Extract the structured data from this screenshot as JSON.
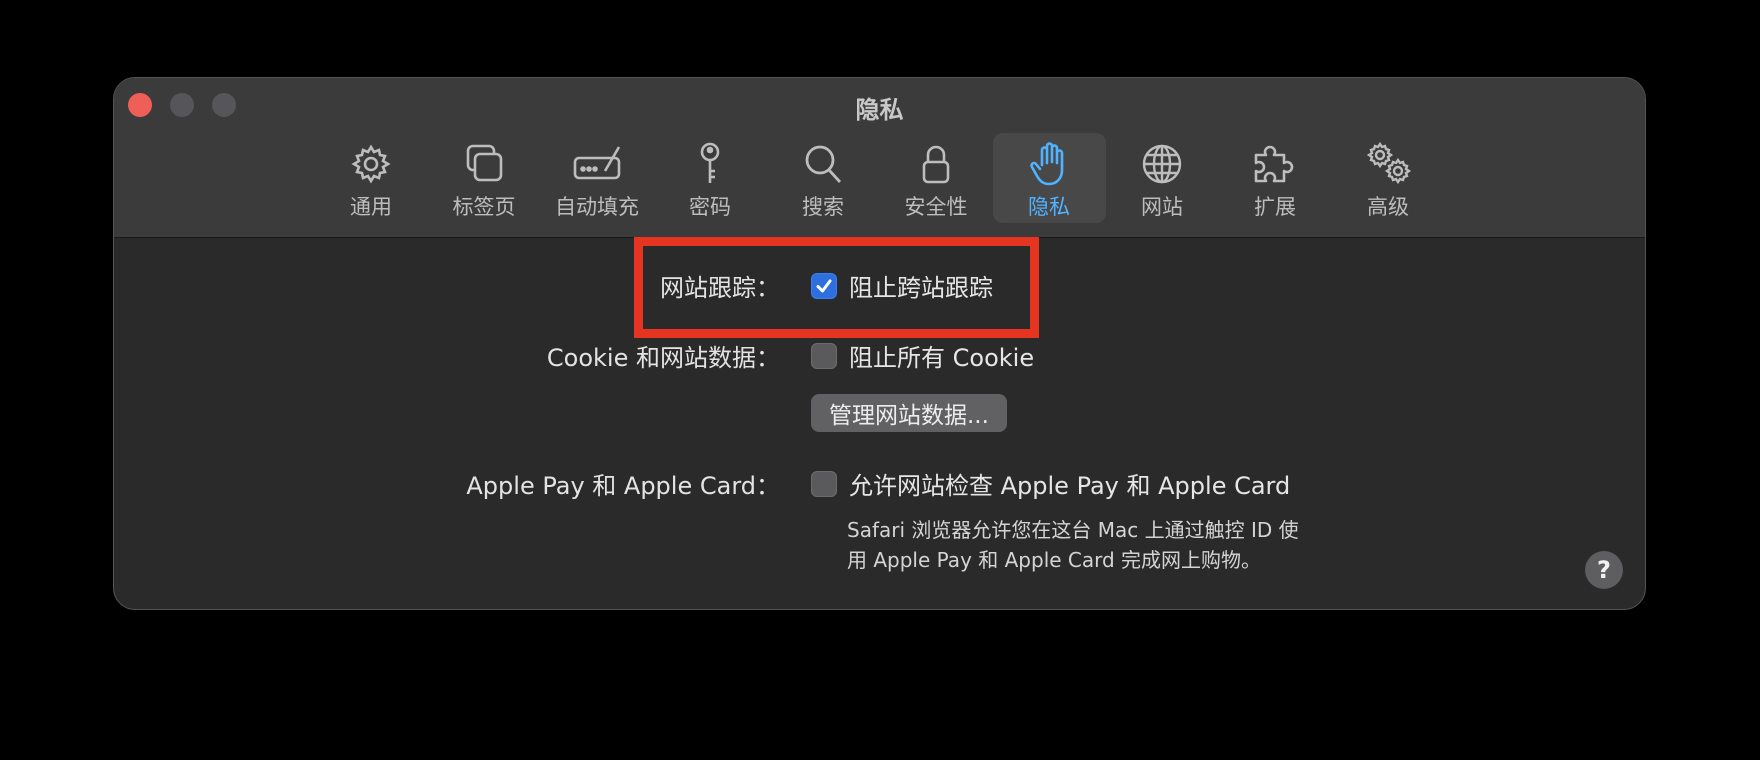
{
  "window": {
    "title": "隐私"
  },
  "toolbar": {
    "items": [
      {
        "label": "通用",
        "icon": "gear-icon"
      },
      {
        "label": "标签页",
        "icon": "tabs-icon"
      },
      {
        "label": "自动填充",
        "icon": "autofill-icon"
      },
      {
        "label": "密码",
        "icon": "key-icon"
      },
      {
        "label": "搜索",
        "icon": "magnifier-icon"
      },
      {
        "label": "安全性",
        "icon": "lock-icon"
      },
      {
        "label": "隐私",
        "icon": "hand-icon",
        "active": true
      },
      {
        "label": "网站",
        "icon": "globe-icon"
      },
      {
        "label": "扩展",
        "icon": "puzzle-icon"
      },
      {
        "label": "高级",
        "icon": "gears-icon"
      }
    ]
  },
  "settings": {
    "tracking": {
      "label": "网站跟踪：",
      "checkbox_label": "阻止跨站跟踪",
      "checked": true
    },
    "cookies": {
      "label": "Cookie 和网站数据：",
      "checkbox_label": "阻止所有 Cookie",
      "checked": false,
      "button_label": "管理网站数据..."
    },
    "applepay": {
      "label": "Apple Pay 和 Apple Card：",
      "checkbox_label": "允许网站检查 Apple Pay 和 Apple Card",
      "checked": false,
      "description_line1": "Safari 浏览器允许您在这台 Mac 上通过触控 ID 使",
      "description_line2": "用 Apple Pay 和 Apple Card 完成网上购物。"
    }
  },
  "help": {
    "label": "?"
  },
  "colors": {
    "accent": "#4fb3ff",
    "checkbox_checked": "#2e6fe0",
    "highlight": "#e5341f"
  }
}
